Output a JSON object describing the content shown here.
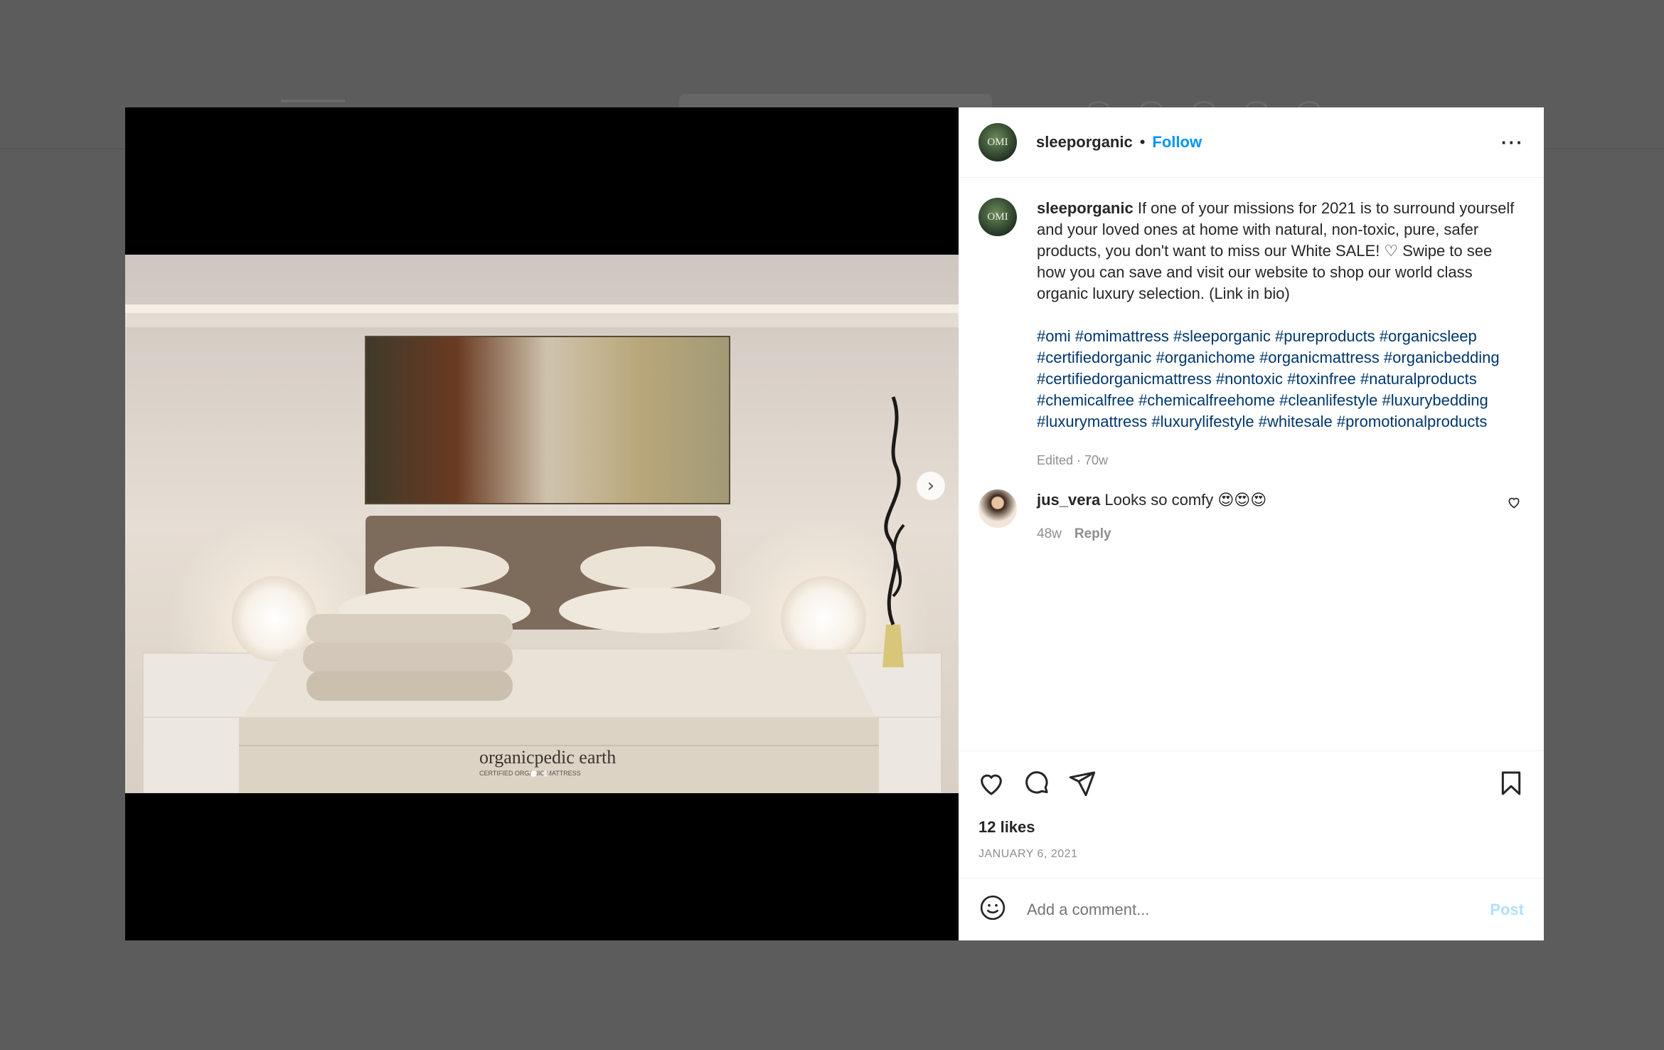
{
  "post": {
    "username": "sleeporganic",
    "avatar_text": "OMI",
    "separator": "•",
    "follow_label": "Follow",
    "more_label": "···"
  },
  "caption": {
    "username": "sleeporganic",
    "text": "If one of your missions for 2021 is to surround yourself and your loved ones at home with natural, non-toxic, pure, safer products, you don't want to miss our White SALE! ♡ Swipe to see how you can save and visit our website to shop our world class organic luxury selection. (Link in bio)",
    "hashtags": "#omi #omimattress #sleeporganic #pureproducts #organicsleep #certifiedorganic #organichome #organicmattress #organicbedding #certifiedorganicmattress #nontoxic #toxinfree #naturalproducts #chemicalfree #chemicalfreehome #cleanlifestyle #luxurybedding #luxurymattress #luxurylifestyle #whitesale #promotionalproducts",
    "meta": "Edited · 70w"
  },
  "comment": {
    "username": "jus_vera",
    "text": "Looks so comfy 😍😍😍",
    "age": "48w",
    "reply_label": "Reply"
  },
  "stats": {
    "likes": "12 likes",
    "date": "JANUARY 6, 2021"
  },
  "composer": {
    "placeholder": "Add a comment...",
    "post_label": "Post"
  },
  "media": {
    "next_label": "›",
    "slide_count": 2,
    "active_slide": 1,
    "brand_text": "organicpedic earth",
    "brand_subtext": "CERTIFIED ORGANIC MATTRESS"
  },
  "colors": {
    "link": "#0095f6",
    "hashtag": "#00376b",
    "muted": "#8e8e8e",
    "post_disabled": "#b2dffc",
    "overlay": "#5c5c5c"
  },
  "icons": [
    "heart-icon",
    "comment-icon",
    "share-icon",
    "bookmark-icon",
    "emoji-icon",
    "chevron-right-icon",
    "more-icon"
  ]
}
